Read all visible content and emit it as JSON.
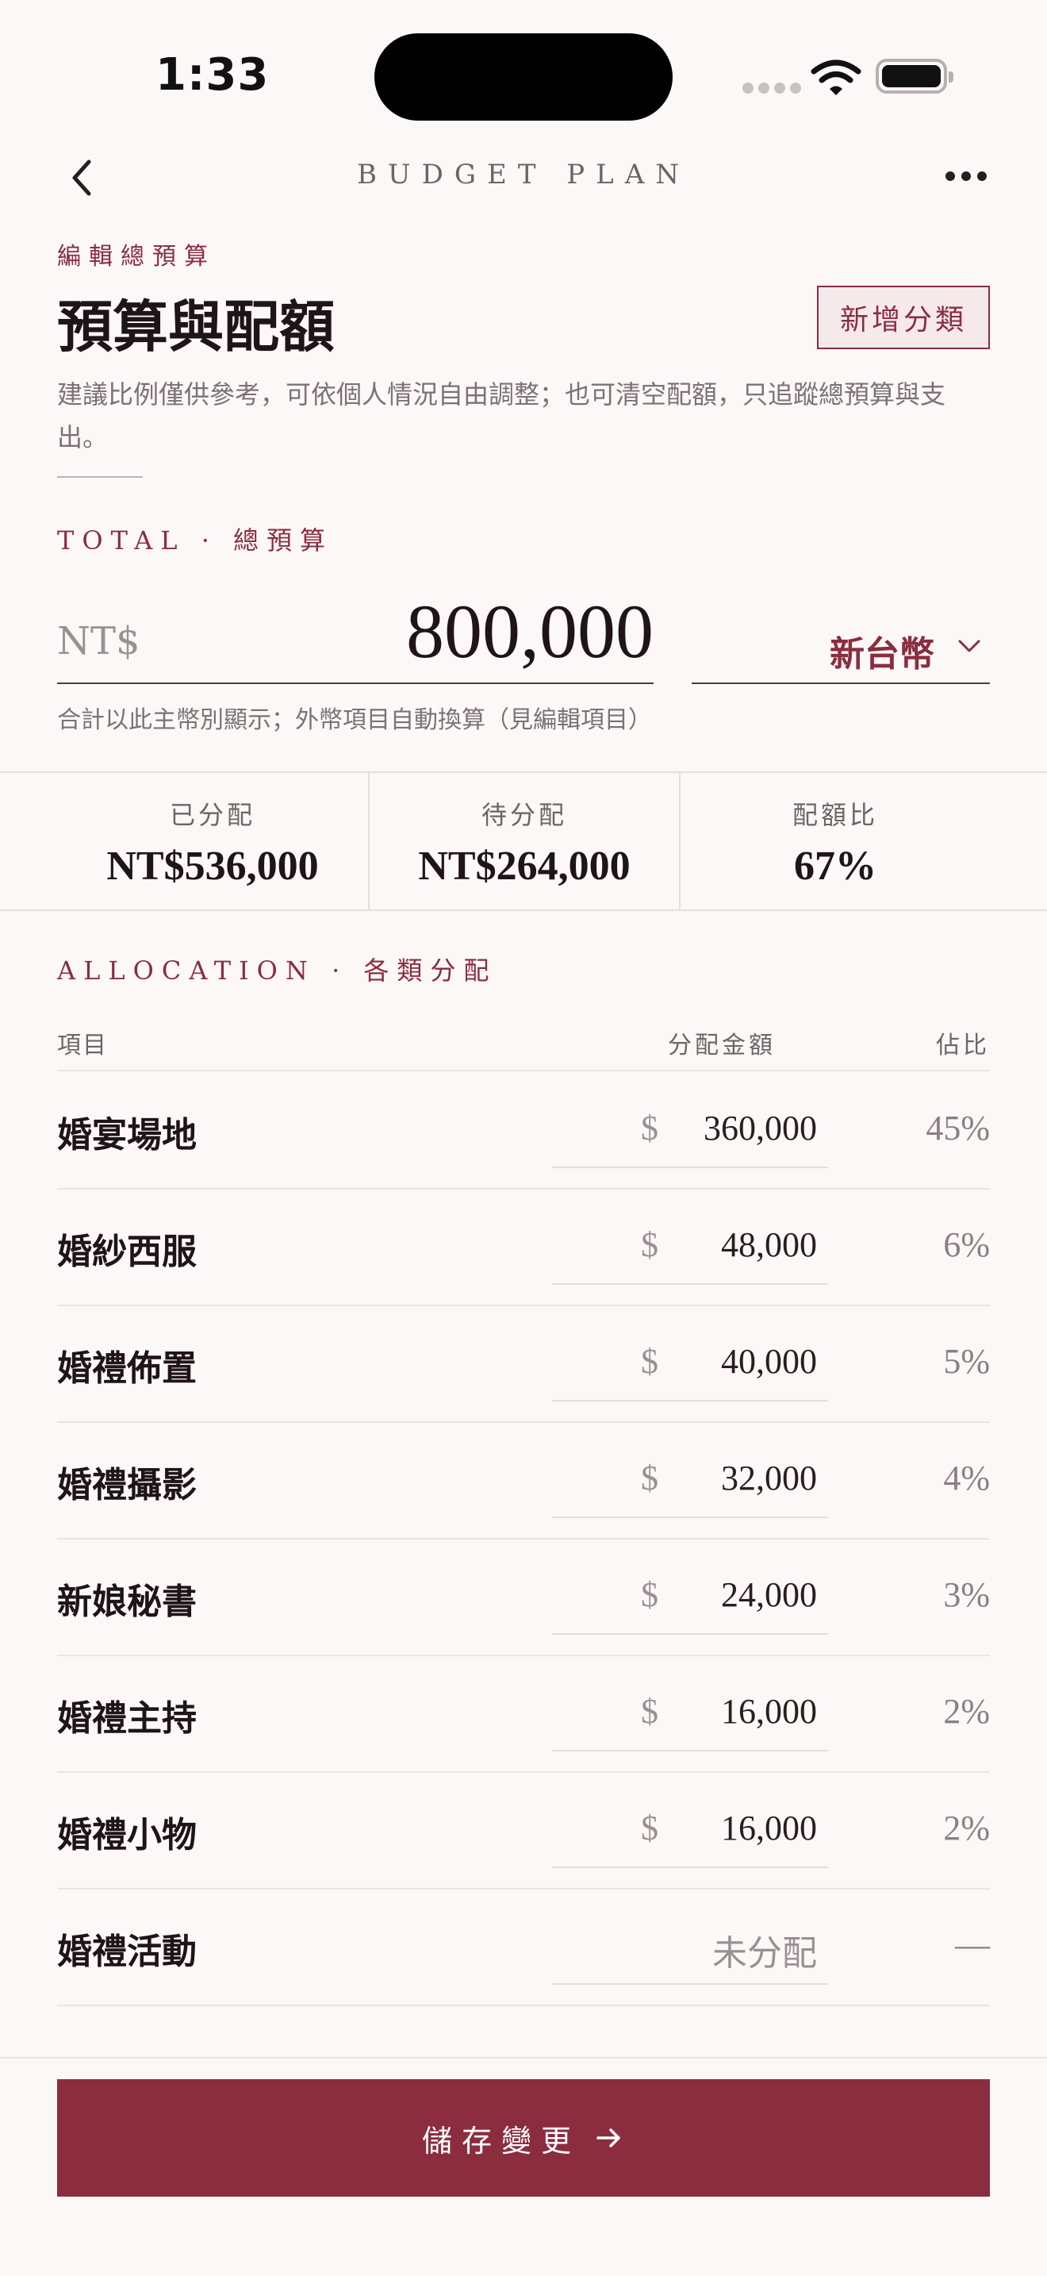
{
  "status": {
    "time": "1:33"
  },
  "nav": {
    "title": "BUDGET PLAN"
  },
  "header": {
    "eyebrow": "編輯總預算",
    "title": "預算與配額",
    "add_category_label": "新增分類",
    "description": "建議比例僅供參考，可依個人情況自由調整；也可清空配額，只追蹤總預算與支出。"
  },
  "total": {
    "section_label_en": "TOTAL",
    "section_sep": "·",
    "section_label": "總預算",
    "prefix": "NT$",
    "amount": "800,000",
    "currency": "新台幣",
    "hint": "合計以此主幣別顯示；外幣項目自動換算（見編輯項目）"
  },
  "summary": [
    {
      "label": "已分配",
      "value": "NT$536,000"
    },
    {
      "label": "待分配",
      "value": "NT$264,000"
    },
    {
      "label": "配額比",
      "value": "67%"
    }
  ],
  "allocation": {
    "section_label_en": "ALLOCATION",
    "section_sep": "·",
    "section_label": "各類分配",
    "col_item": "項目",
    "col_amount": "分配金額",
    "col_pct": "佔比",
    "currency_symbol": "$",
    "rows": [
      {
        "name": "婚宴場地",
        "amount": "360,000",
        "pct": "45%"
      },
      {
        "name": "婚紗西服",
        "amount": "48,000",
        "pct": "6%"
      },
      {
        "name": "婚禮佈置",
        "amount": "40,000",
        "pct": "5%"
      },
      {
        "name": "婚禮攝影",
        "amount": "32,000",
        "pct": "4%"
      },
      {
        "name": "新娘秘書",
        "amount": "24,000",
        "pct": "3%"
      },
      {
        "name": "婚禮主持",
        "amount": "16,000",
        "pct": "2%"
      },
      {
        "name": "婚禮小物",
        "amount": "16,000",
        "pct": "2%"
      },
      {
        "name": "婚禮活動",
        "amount": "未分配",
        "pct": "—"
      }
    ]
  },
  "footer": {
    "save_label": "儲存變更"
  },
  "colors": {
    "accent": "#8b2d3f",
    "background": "#fbf8f7",
    "text": "#2a1d20"
  },
  "icons": {
    "back": "chevron-left-icon",
    "more": "more-horizontal-icon",
    "currency_chevron": "chevron-down-icon",
    "save_arrow": "arrow-right-icon"
  }
}
